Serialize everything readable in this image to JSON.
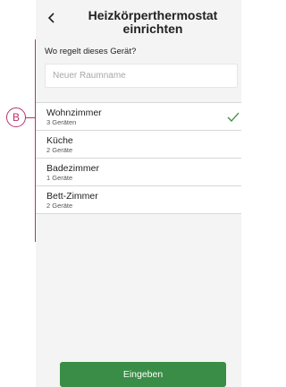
{
  "header": {
    "back_icon": "chevron-left-icon",
    "title": "Heizkörperthermostat einrichten"
  },
  "form": {
    "prompt": "Wo regelt dieses Gerät?",
    "room_name_placeholder": "Neuer Raumname",
    "room_name_value": ""
  },
  "rooms": [
    {
      "name": "Wohnzimmer",
      "count": "3 Geräten",
      "selected": true
    },
    {
      "name": "Küche",
      "count": "2 Geräte",
      "selected": false
    },
    {
      "name": "Badezimmer",
      "count": "1 Geräte",
      "selected": false
    },
    {
      "name": "Bett-Zimmer",
      "count": "2 Geräte",
      "selected": false
    }
  ],
  "selected_icon": "checkmark-icon",
  "annotation": {
    "label": "B",
    "color": "#b5316f"
  },
  "submit": {
    "label": "Eingeben",
    "color": "#3a8d46"
  }
}
